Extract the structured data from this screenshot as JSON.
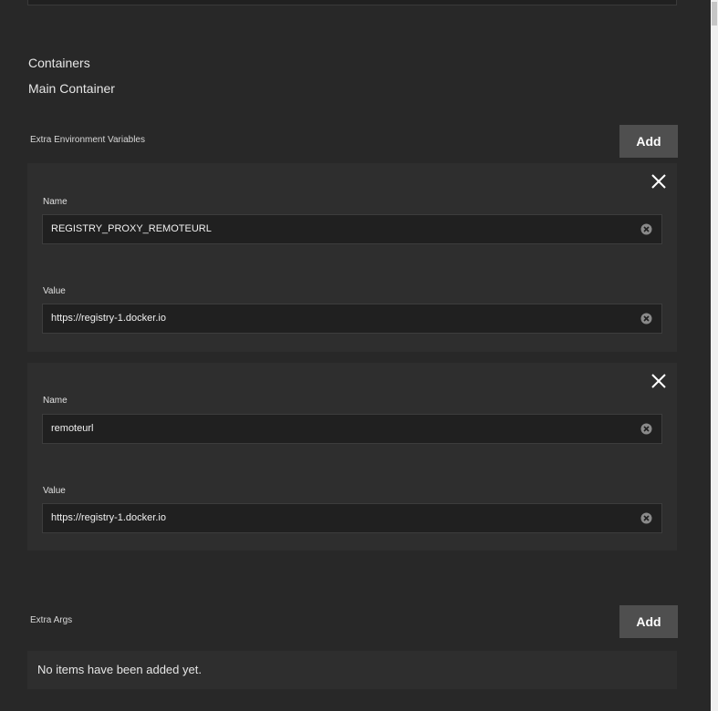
{
  "containers": {
    "heading": "Containers",
    "subheading": "Main Container"
  },
  "env_vars": {
    "label": "Extra Environment Variables",
    "add_label": "Add",
    "items": [
      {
        "name_label": "Name",
        "name_value": "REGISTRY_PROXY_REMOTEURL",
        "value_label": "Value",
        "value_value": "https://registry-1.docker.io"
      },
      {
        "name_label": "Name",
        "name_value": "remoteurl",
        "value_label": "Value",
        "value_value": "https://registry-1.docker.io"
      }
    ]
  },
  "extra_args": {
    "label": "Extra Args",
    "add_label": "Add",
    "empty_text": "No items have been added yet."
  },
  "icons": {
    "remove": "close-icon",
    "clear": "clear-circle-icon"
  },
  "colors": {
    "background": "#282828",
    "card": "#2e2e2e",
    "input": "#202020",
    "button": "#4f4f4f"
  }
}
